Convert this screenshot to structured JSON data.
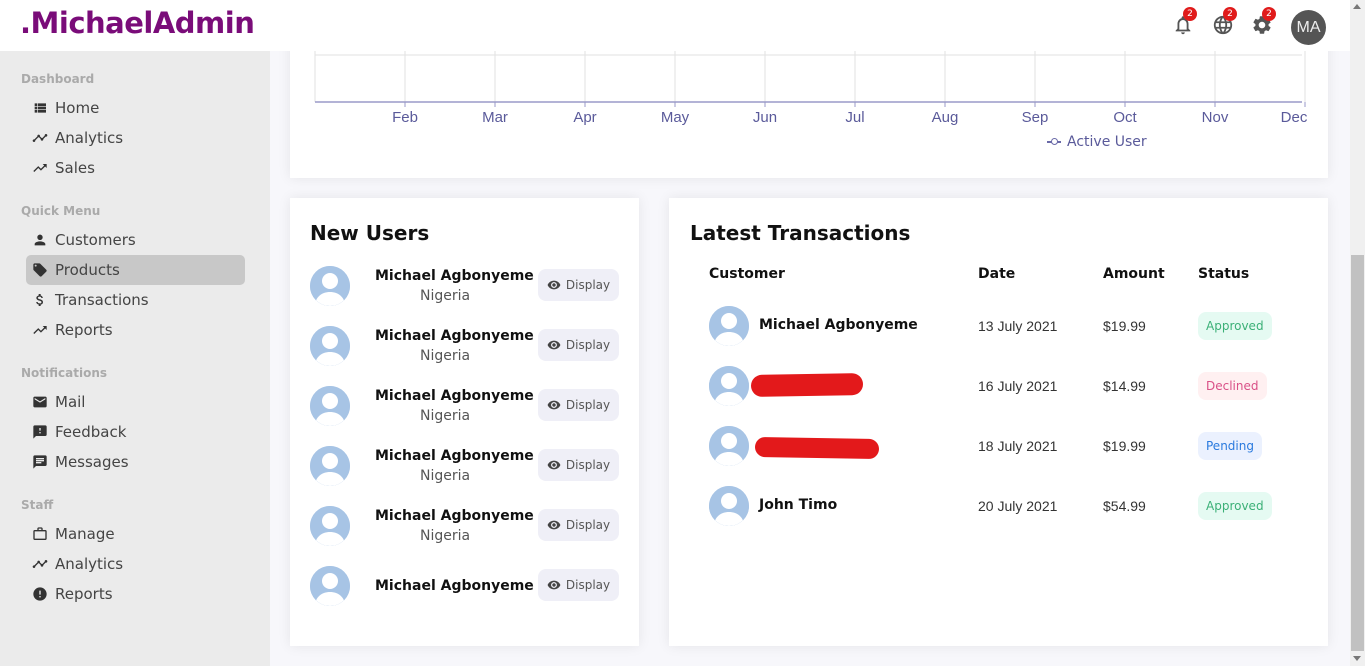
{
  "app": {
    "logo": ".MichaelAdmin",
    "notifications_badge": "2",
    "language_badge": "2",
    "settings_badge": "2",
    "avatar_initials": "MA"
  },
  "sidebar": {
    "sections": [
      {
        "title": "Dashboard",
        "items": [
          {
            "label": "Home",
            "icon": "home-icon"
          },
          {
            "label": "Analytics",
            "icon": "timeline-icon"
          },
          {
            "label": "Sales",
            "icon": "trending-up-icon"
          }
        ]
      },
      {
        "title": "Quick Menu",
        "items": [
          {
            "label": "Customers",
            "icon": "person-icon"
          },
          {
            "label": "Products",
            "icon": "tag-icon",
            "active": true
          },
          {
            "label": "Transactions",
            "icon": "dollar-icon"
          },
          {
            "label": "Reports",
            "icon": "trending-up-icon"
          }
        ]
      },
      {
        "title": "Notifications",
        "items": [
          {
            "label": "Mail",
            "icon": "mail-icon"
          },
          {
            "label": "Feedback",
            "icon": "feedback-icon"
          },
          {
            "label": "Messages",
            "icon": "chat-icon"
          }
        ]
      },
      {
        "title": "Staff",
        "items": [
          {
            "label": "Manage",
            "icon": "briefcase-icon"
          },
          {
            "label": "Analytics",
            "icon": "timeline-icon"
          },
          {
            "label": "Reports",
            "icon": "error-icon"
          }
        ]
      }
    ]
  },
  "chart_data": {
    "type": "line",
    "categories": [
      "Feb",
      "Mar",
      "Apr",
      "May",
      "Jun",
      "Jul",
      "Aug",
      "Sep",
      "Oct",
      "Nov",
      "Dec"
    ],
    "series": [
      {
        "name": "Active User",
        "values": []
      }
    ],
    "grid": true,
    "legend": "bottom"
  },
  "new_users": {
    "title": "New Users",
    "button_label": "Display",
    "users": [
      {
        "name": "Michael Agbonyeme",
        "country": "Nigeria"
      },
      {
        "name": "Michael Agbonyeme",
        "country": "Nigeria"
      },
      {
        "name": "Michael Agbonyeme",
        "country": "Nigeria"
      },
      {
        "name": "Michael Agbonyeme",
        "country": "Nigeria"
      },
      {
        "name": "Michael Agbonyeme",
        "country": "Nigeria"
      },
      {
        "name": "Michael Agbonyeme",
        "country": ""
      }
    ]
  },
  "transactions": {
    "title": "Latest Transactions",
    "headers": [
      "Customer",
      "Date",
      "Amount",
      "Status"
    ],
    "rows": [
      {
        "customer": "Michael Agbonyeme",
        "date": "13 July 2021",
        "amount": "$19.99",
        "status": "Approved"
      },
      {
        "customer": "",
        "date": "16 July 2021",
        "amount": "$14.99",
        "status": "Declined"
      },
      {
        "customer": "",
        "date": "18 July 2021",
        "amount": "$19.99",
        "status": "Pending"
      },
      {
        "customer": "John Timo",
        "date": "20 July 2021",
        "amount": "$54.99",
        "status": "Approved"
      }
    ],
    "status_colors": {
      "Approved": {
        "bg": "#e5faf2",
        "fg": "#3bb077"
      },
      "Declined": {
        "bg": "#fff0f1",
        "fg": "#d95087"
      },
      "Pending": {
        "bg": "#ebf1fe",
        "fg": "#2a7ade"
      }
    }
  },
  "colors": {
    "brand": "#7a0c79",
    "badge": "#e01b1b",
    "chart_axis": "#5a5a9a"
  }
}
